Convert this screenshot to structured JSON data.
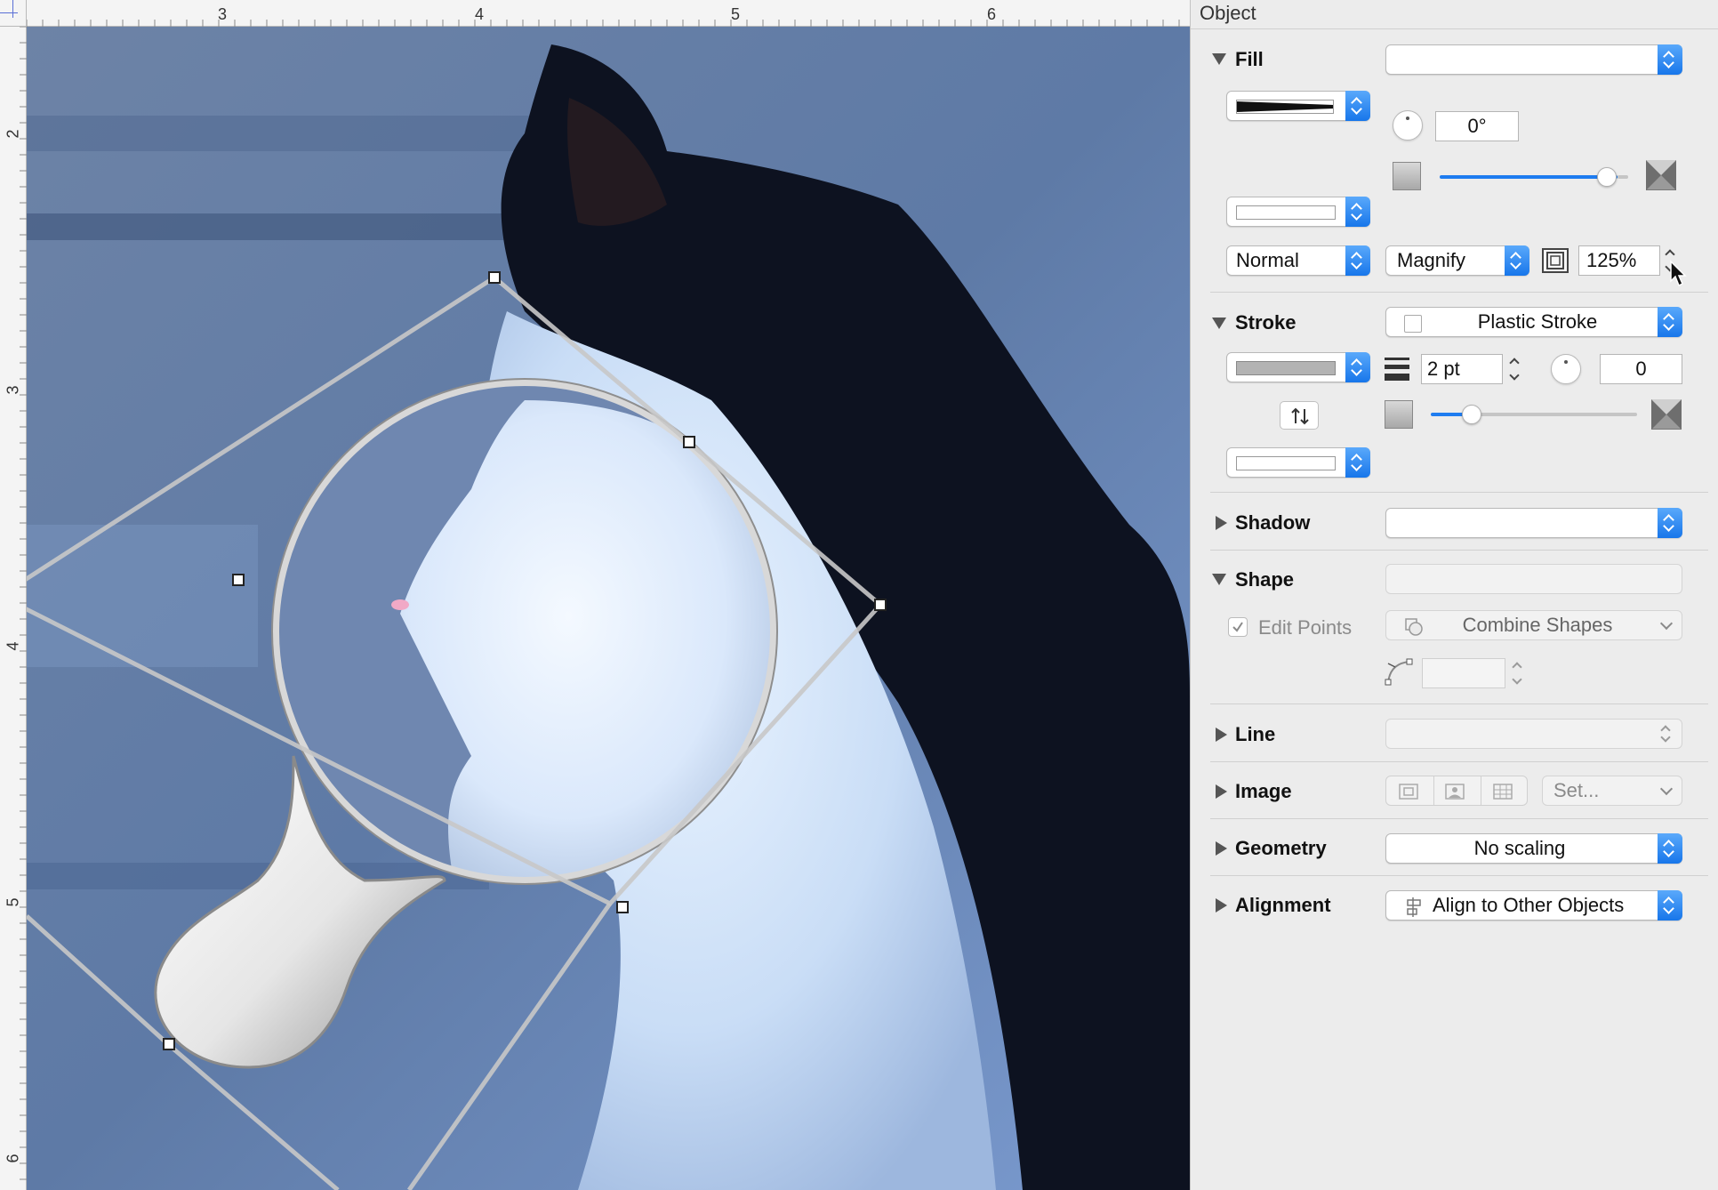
{
  "canvas": {
    "ruler_top_labels": [
      "3",
      "4",
      "5",
      "6"
    ],
    "ruler_left_labels": [
      "2",
      "3",
      "4",
      "5",
      "6"
    ],
    "photo_description_icon": "cat-photo"
  },
  "inspector": {
    "title": "Object",
    "fill": {
      "label": "Fill",
      "type_value": "",
      "angle": "0°",
      "blend_mode": "Normal",
      "effect": "Magnify",
      "magnify_percent": "125%",
      "slider_fraction": 0.94
    },
    "stroke": {
      "label": "Stroke",
      "style": "Plastic Stroke",
      "width": "2 pt",
      "corner_radius": "0",
      "slider_fraction": 0.2
    },
    "shadow": {
      "label": "Shadow",
      "value": ""
    },
    "shape": {
      "label": "Shape",
      "edit_points_label": "Edit Points",
      "edit_points_checked": true,
      "combine_label": "Combine Shapes",
      "point_value": ""
    },
    "line": {
      "label": "Line"
    },
    "image": {
      "label": "Image",
      "set_label": "Set..."
    },
    "geometry": {
      "label": "Geometry",
      "value": "No scaling"
    },
    "alignment": {
      "label": "Alignment",
      "value": "Align to Other Objects"
    }
  },
  "colors": {
    "accent": "#1a7cf0",
    "photo_tint": "#6f8fc0"
  }
}
